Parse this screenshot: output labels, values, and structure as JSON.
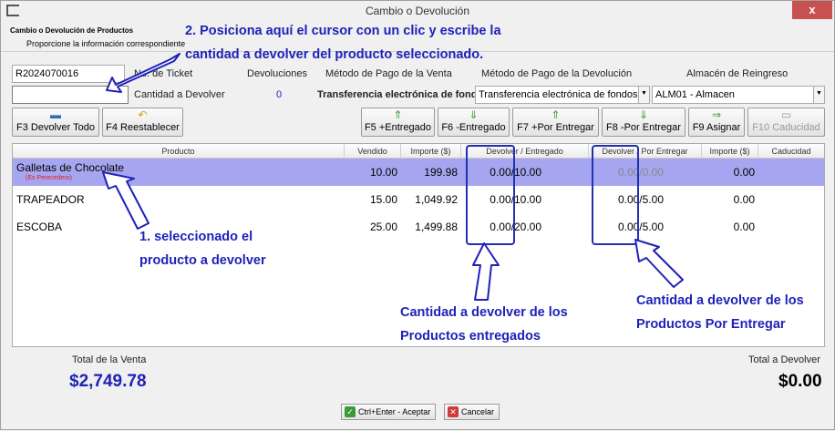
{
  "window": {
    "title": "Cambio o Devolución",
    "close_label": "x"
  },
  "header": {
    "title": "Cambio o Devolución de Productos",
    "subtitle": "Proporcione la información correspondiente"
  },
  "fields": {
    "ticket_value": "R2024070016",
    "ticket_label": "No. de Ticket",
    "devoluciones_label": "Devoluciones",
    "devoluciones_value": "0",
    "metodo_venta_label": "Método de Pago de la Venta",
    "metodo_venta_value": "Transferencia electrónica de fondos",
    "metodo_dev_label": "Método de Pago de la Devolución",
    "metodo_dev_value": "Transferencia electrónica de fondos",
    "almacen_label": "Almacén de Reingreso",
    "almacen_value": "ALM01 - Almacen",
    "cantidad_label": "Cantidad a Devolver",
    "cantidad_value": ""
  },
  "toolbar": {
    "devolver_todo": "F3 Devolver Todo",
    "reestablecer": "F4 Reestablecer",
    "mas_entregado": "F5 +Entregado",
    "menos_entregado": "F6 -Entregado",
    "mas_por_entregar": "F7 +Por Entregar",
    "menos_por_entregar": "F8 -Por Entregar",
    "asignar": "F9 Asignar",
    "caducidad": "F10 Caducidad"
  },
  "table": {
    "columns": [
      "Producto",
      "Vendido",
      "Importe ($)",
      "Devolver / Entregado",
      "Devolver / Por Entregar",
      "Importe ($)",
      "Caducidad"
    ],
    "rows": [
      {
        "producto": "Galletas de Chocolate",
        "nota": "(Es Perecedero)",
        "vendido": "10.00",
        "importe": "199.98",
        "dev_entregado": "0.00/10.00",
        "dev_por_entregar": "0.00/0.00",
        "importe_dev": "0.00",
        "caducidad": ""
      },
      {
        "producto": "TRAPEADOR",
        "nota": "",
        "vendido": "15.00",
        "importe": "1,049.92",
        "dev_entregado": "0.00/10.00",
        "dev_por_entregar": "0.00/5.00",
        "importe_dev": "0.00",
        "caducidad": ""
      },
      {
        "producto": "ESCOBA",
        "nota": "",
        "vendido": "25.00",
        "importe": "1,499.88",
        "dev_entregado": "0.00/20.00",
        "dev_por_entregar": "0.00/5.00",
        "importe_dev": "0.00",
        "caducidad": ""
      }
    ]
  },
  "footer": {
    "total_venta_label": "Total de la Venta",
    "total_venta_value": "$2,749.78",
    "total_devolver_label": "Total a Devolver",
    "total_devolver_value": "$0.00",
    "aceptar_label": "Ctrl+Enter - Aceptar",
    "cancelar_label": "Cancelar"
  },
  "annotations": {
    "step2_line1": "2. Posiciona aquí el cursor con un clic y escribe la",
    "step2_line2": "cantidad a devolver del producto seleccionado.",
    "step1_line1": "1. seleccionado el",
    "step1_line2": "producto a devolver",
    "entregados_line1": "Cantidad a devolver de los",
    "entregados_line2": "Productos entregados",
    "por_entregar_line1": "Cantidad a devolver de los",
    "por_entregar_line2": "Productos Por Entregar"
  },
  "colors": {
    "selected_row": "#a6a6f0",
    "annotation": "#1e22b8",
    "total_venta": "#1e22b8",
    "perecedero": "#e02020"
  }
}
